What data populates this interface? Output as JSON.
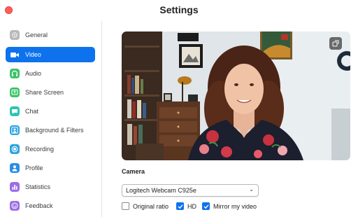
{
  "window": {
    "title": "Settings"
  },
  "sidebar": {
    "items": [
      {
        "label": "General",
        "icon": "gear-icon",
        "color": "#b8b8b8"
      },
      {
        "label": "Video",
        "icon": "video-camera-icon",
        "color": "#0e72ed"
      },
      {
        "label": "Audio",
        "icon": "headphones-icon",
        "color": "#3cc46a"
      },
      {
        "label": "Share Screen",
        "icon": "share-screen-icon",
        "color": "#3cc46a"
      },
      {
        "label": "Chat",
        "icon": "chat-bubble-icon",
        "color": "#2bc4b4"
      },
      {
        "label": "Background & Filters",
        "icon": "person-frame-icon",
        "color": "#2aa3e0"
      },
      {
        "label": "Recording",
        "icon": "record-icon",
        "color": "#2aa3e0"
      },
      {
        "label": "Profile",
        "icon": "person-icon",
        "color": "#2b8ee8"
      },
      {
        "label": "Statistics",
        "icon": "bar-chart-icon",
        "color": "#9b6ce6"
      },
      {
        "label": "Feedback",
        "icon": "smiley-icon",
        "color": "#9b6ce6"
      }
    ],
    "active_index": 1
  },
  "main": {
    "camera_label": "Camera",
    "camera_select": {
      "value": "Logitech Webcam C925e"
    },
    "options": {
      "original_ratio": {
        "label": "Original ratio",
        "checked": false
      },
      "hd": {
        "label": "HD",
        "checked": true
      },
      "mirror": {
        "label": "Mirror my video",
        "checked": true
      }
    }
  },
  "colors": {
    "accent": "#0e72ed",
    "close": "#ff5f57"
  }
}
